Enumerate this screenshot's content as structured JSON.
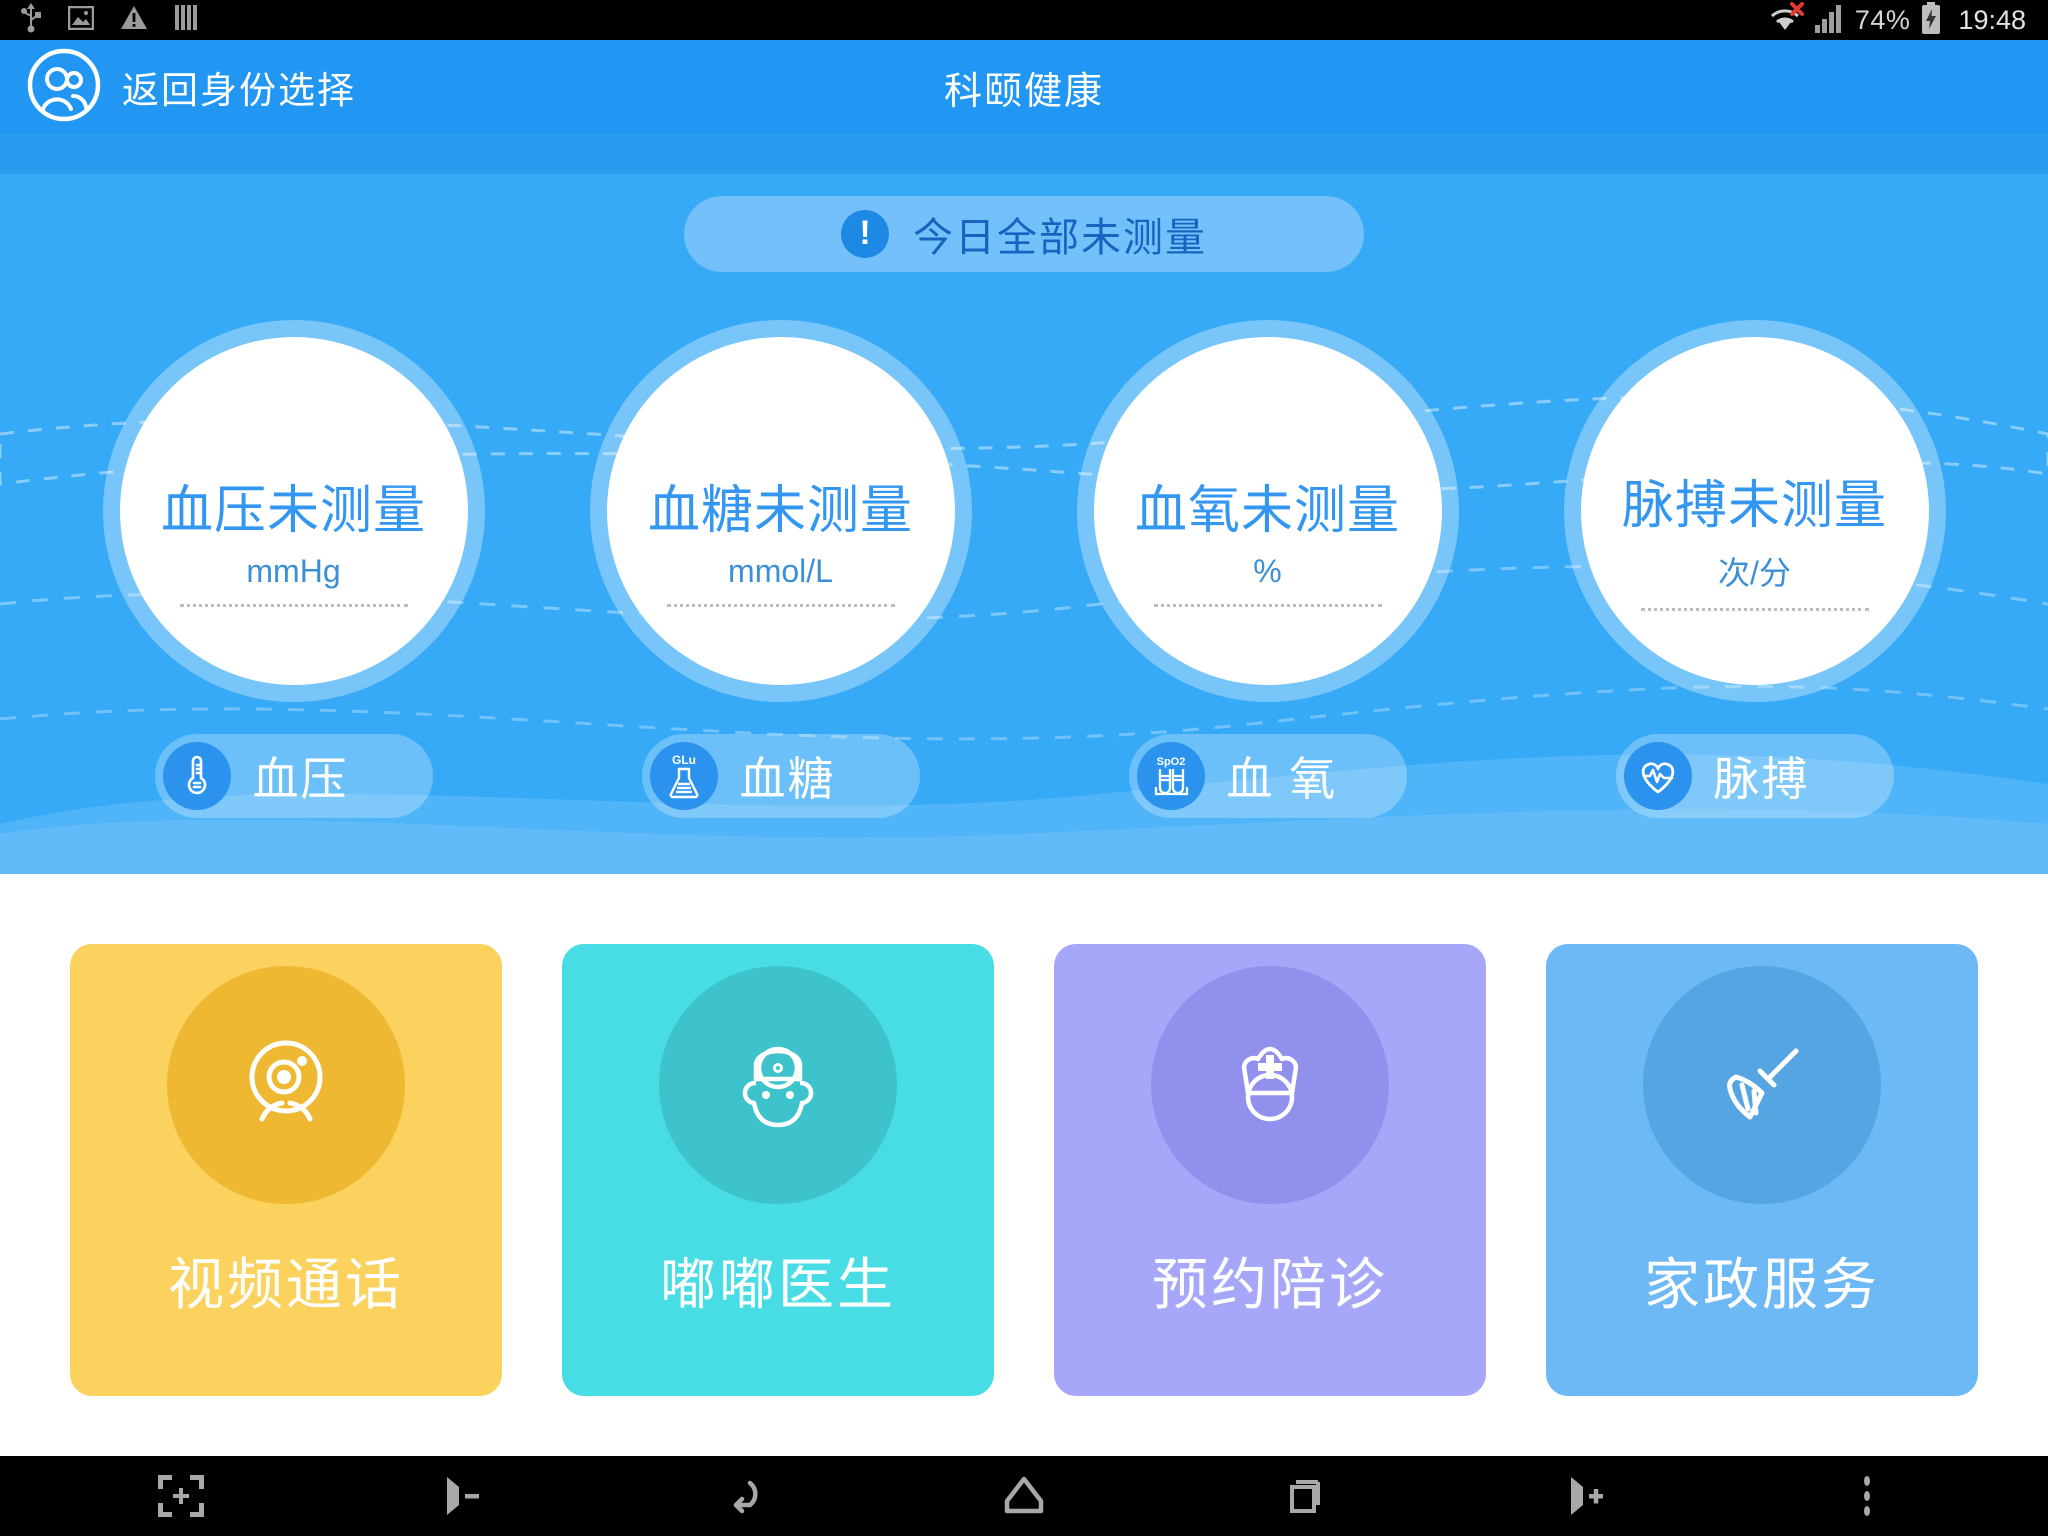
{
  "statusbar": {
    "left_icons": [
      "usb-icon",
      "screenshot-image-icon",
      "warning-triangle-icon",
      "bars-icon"
    ],
    "wifi_icon": "wifi-no-internet-icon",
    "wifi_error_mark": "×",
    "signal_icon": "cellular-signal-icon",
    "battery_percent": "74%",
    "battery_icon": "battery-charging-icon",
    "time": "19:48"
  },
  "header": {
    "back_icon": "users-circle-icon",
    "back_label": "返回身份选择",
    "title": "科颐健康",
    "bg_color": "#2196f3"
  },
  "notice": {
    "badge_icon": "exclamation-icon",
    "badge_symbol": "!",
    "text": "今日全部未测量",
    "bg_color": "#74c0fb",
    "text_color": "#1565c0"
  },
  "metrics": [
    {
      "title": "血压未测量",
      "unit": "mmHg",
      "pill_label": "血压",
      "pill_icon": "thermometer-icon",
      "icon_text": ""
    },
    {
      "title": "血糖未测量",
      "unit": "mmol/L",
      "pill_label": "血糖",
      "pill_icon": "flask-icon",
      "icon_text": "GLu"
    },
    {
      "title": "血氧未测量",
      "unit": "%",
      "pill_label": "血 氧",
      "pill_icon": "test-tubes-icon",
      "icon_text": "SpO2"
    },
    {
      "title": "脉搏未测量",
      "unit": "次/分",
      "pill_label": "脉搏",
      "pill_icon": "heart-pulse-icon",
      "icon_text": ""
    }
  ],
  "service_cards": [
    {
      "label": "视频通话",
      "icon": "webcam-icon",
      "bg": "#fbd25e",
      "circle": "#eeb833"
    },
    {
      "label": "嘟嘟医生",
      "icon": "doctor-head-icon",
      "bg": "#48dde5",
      "circle": "#3ec3cc"
    },
    {
      "label": "预约陪诊",
      "icon": "nurse-cap-icon",
      "bg": "#a6a7f8",
      "circle": "#9190ec"
    },
    {
      "label": "家政服务",
      "icon": "broom-icon",
      "bg": "#6cb9f5",
      "circle": "#55a5e2"
    }
  ],
  "navbar": {
    "buttons": [
      {
        "name": "screenshot-icon"
      },
      {
        "name": "volume-down-icon"
      },
      {
        "name": "back-icon"
      },
      {
        "name": "home-icon"
      },
      {
        "name": "recents-icon"
      },
      {
        "name": "volume-up-icon"
      },
      {
        "name": "overflow-menu-icon"
      }
    ]
  },
  "colors": {
    "brand_blue": "#2196f3",
    "panel_blue": "#36a9f7",
    "metric_text": "#3396f0"
  }
}
